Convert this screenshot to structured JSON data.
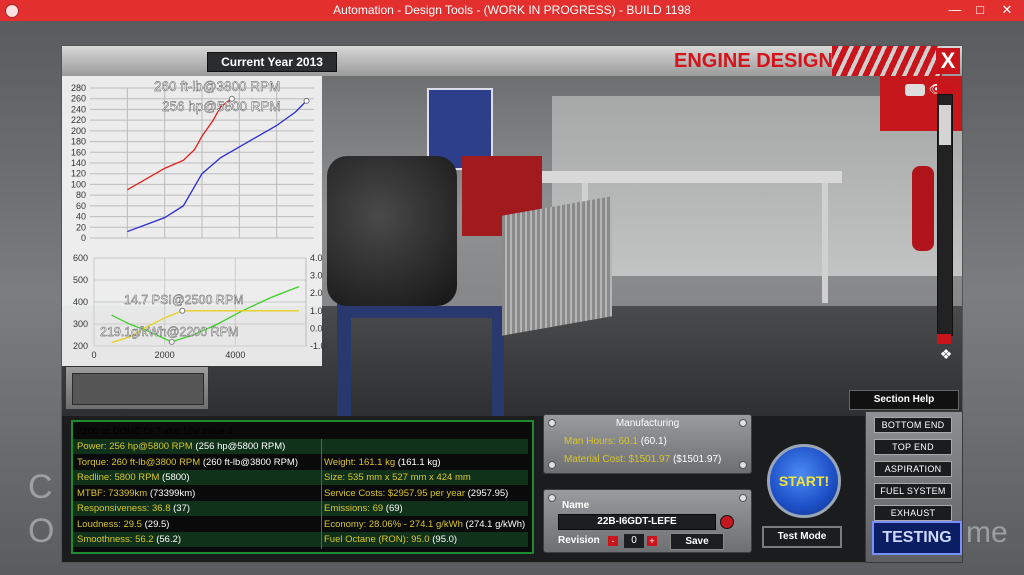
{
  "window": {
    "title": "Automation - Design Tools - (WORK IN PROGRESS) - BUILD 1198",
    "minimize": "—",
    "maximize": "□",
    "close": "✕"
  },
  "background": {
    "text1": "C",
    "text2": "O",
    "text3": "me"
  },
  "header": {
    "year_label": "Current Year 2013",
    "title": "ENGINE DESIGN",
    "close_label": "X"
  },
  "colors": {
    "accent_red": "#c8141a",
    "label_yellow": "#d9c52a",
    "panel_green": "#1e8a2e",
    "torque_curve": "#e0201b",
    "power_curve": "#2b2bd8",
    "green_curve": "#3fce2a",
    "yellow_curve": "#e8d020"
  },
  "chart_data": [
    {
      "type": "line",
      "title": "",
      "ylim": [
        0,
        280
      ],
      "y_ticks": [
        "280",
        "260",
        "240",
        "220",
        "200",
        "180",
        "160",
        "140",
        "120",
        "100",
        "80",
        "60",
        "40",
        "20",
        "0"
      ],
      "annotations": [
        "260 ft-lb@3800 RPM",
        "256 hp@5800 RPM"
      ],
      "series": [
        {
          "name": "",
          "color": "torque",
          "x": [
            1000,
            1500,
            2000,
            2500,
            2800,
            3000,
            3300,
            3500,
            3800
          ],
          "y": [
            90,
            110,
            130,
            145,
            165,
            190,
            220,
            245,
            260
          ]
        },
        {
          "name": "",
          "color": "power",
          "x": [
            1000,
            1500,
            2000,
            2500,
            3000,
            3500,
            4000,
            4500,
            5000,
            5500,
            5800
          ],
          "y": [
            12,
            25,
            38,
            60,
            120,
            150,
            170,
            190,
            210,
            235,
            256
          ]
        }
      ]
    },
    {
      "type": "line",
      "title": "",
      "ylim": [
        200,
        600
      ],
      "y2lim": [
        -1.0,
        4.0
      ],
      "x_ticks": [
        "0",
        "2000",
        "4000"
      ],
      "y_ticks": [
        "600",
        "500",
        "400",
        "300",
        "200"
      ],
      "y2_ticks": [
        "4.0",
        "3.0",
        "2.0",
        "1.0",
        "0.0",
        "-1.0"
      ],
      "annotations": [
        "14.7 PSI@2500 RPM",
        "219.1g/kWh@2200 RPM"
      ],
      "series": [
        {
          "name": "",
          "color": "green",
          "axis": "left",
          "x": [
            500,
            1000,
            1500,
            2200,
            2800,
            3500,
            4200,
            5000,
            5800
          ],
          "y": [
            340,
            300,
            270,
            219,
            250,
            300,
            360,
            420,
            470
          ]
        },
        {
          "name": "",
          "color": "yellow",
          "axis": "right",
          "x": [
            500,
            1000,
            1500,
            2000,
            2500,
            3500,
            4500,
            5800
          ],
          "y": [
            -0.8,
            -0.5,
            0.1,
            0.6,
            1.0,
            1.0,
            1.0,
            1.0
          ]
        }
      ]
    }
  ],
  "specs": {
    "header": "2200 cc DOHC DI Turbo 16V Inline 4",
    "rows_left": [
      {
        "label": "Power:",
        "value": "256 hp@5800 RPM",
        "paren": "(256 hp@5800 RPM)"
      },
      {
        "label": "Torque:",
        "value": "260 ft-lb@3800 RPM",
        "paren": "(260 ft-lb@3800 RPM)"
      },
      {
        "label": "Redline:",
        "value": "5800 RPM",
        "paren": "(5800)"
      },
      {
        "label": "MTBF:",
        "value": "73399km",
        "paren": "(73399km)"
      },
      {
        "label": "Responsiveness:",
        "value": "36.8",
        "paren": "(37)"
      },
      {
        "label": "Loudness:",
        "value": "29.5",
        "paren": "(29.5)"
      },
      {
        "label": "Smoothness:",
        "value": "56.2",
        "paren": "(56.2)"
      }
    ],
    "rows_right": [
      {
        "label": "",
        "value": "",
        "paren": ""
      },
      {
        "label": "Weight:",
        "value": "161.1 kg",
        "paren": "(161.1 kg)"
      },
      {
        "label": "Size:",
        "value": "535 mm x 527 mm x 424 mm",
        "paren": ""
      },
      {
        "label": "Service Costs:",
        "value": "$2957.95 per year",
        "paren": "(2957.95)"
      },
      {
        "label": "Emissions:",
        "value": "69",
        "paren": "(69)"
      },
      {
        "label": "Economy:",
        "value": "28.06% - 274.1 g/kWh",
        "paren": "(274.1 g/kWh)"
      },
      {
        "label": "Fuel Octane (RON):",
        "value": "95.0",
        "paren": "(95.0)"
      }
    ]
  },
  "manufacturing": {
    "title": "Manufacturing",
    "man_hours_label": "Man Hours:",
    "man_hours_value": "60.1",
    "man_hours_paren": "(60.1)",
    "material_cost_label": "Material Cost:",
    "material_cost_value": "$1501.97",
    "material_cost_paren": "($1501.97)"
  },
  "name_panel": {
    "label": "Name",
    "value": "22B-I6GDT-LEFE",
    "revision_label": "Revision",
    "revision_minus": "-",
    "revision_value": "0",
    "revision_plus": "+",
    "save_label": "Save"
  },
  "actions": {
    "start_label": "START!",
    "test_mode_label": "Test Mode"
  },
  "sections": {
    "help_label": "Section Help",
    "items": [
      "BOTTOM END",
      "TOP END",
      "ASPIRATION",
      "FUEL SYSTEM",
      "EXHAUST"
    ],
    "testing_label": "TESTING"
  }
}
